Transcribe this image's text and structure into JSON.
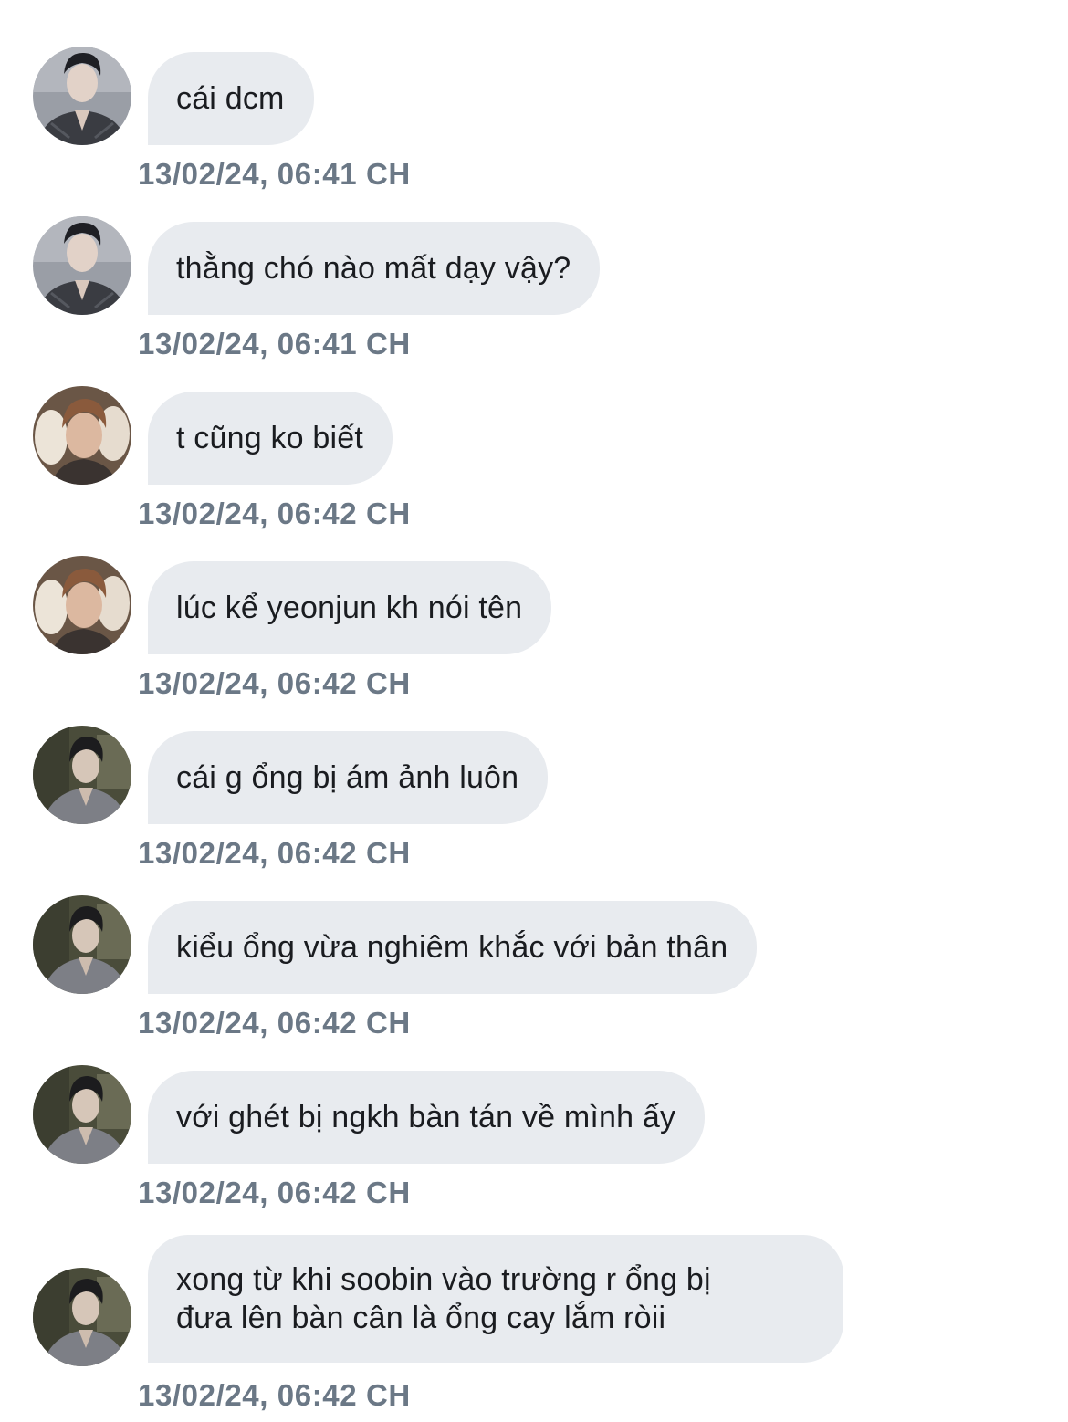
{
  "messages": [
    {
      "text": "cái dcm",
      "timestamp": "13/02/24, 06:41 CH",
      "avatar": "avatar-user-a"
    },
    {
      "text": "thằng chó nào mất dạy vậy?",
      "timestamp": "13/02/24, 06:41 CH",
      "avatar": "avatar-user-a"
    },
    {
      "text": "t cũng ko biết",
      "timestamp": "13/02/24, 06:42 CH",
      "avatar": "avatar-user-b"
    },
    {
      "text": "lúc kể yeonjun kh nói tên",
      "timestamp": "13/02/24, 06:42 CH",
      "avatar": "avatar-user-b"
    },
    {
      "text": "cái g ổng bị ám ảnh luôn",
      "timestamp": "13/02/24, 06:42 CH",
      "avatar": "avatar-user-c"
    },
    {
      "text": "kiểu ổng vừa nghiêm khắc với bản thân",
      "timestamp": "13/02/24, 06:42 CH",
      "avatar": "avatar-user-c"
    },
    {
      "text": "với ghét bị ngkh bàn tán về mình ấy",
      "timestamp": "13/02/24, 06:42 CH",
      "avatar": "avatar-user-c"
    },
    {
      "text_line1": "xong từ khi soobin vào trường r ổng bị",
      "text_line2": "đưa lên bàn cân là ổng cay lắm ròii",
      "timestamp": "13/02/24, 06:42 CH",
      "avatar": "avatar-user-c"
    }
  ],
  "colors": {
    "bubble_bg": "#e8ebef",
    "bubble_text": "#1a1c20",
    "timestamp": "#6b7886",
    "page_bg": "#ffffff"
  }
}
